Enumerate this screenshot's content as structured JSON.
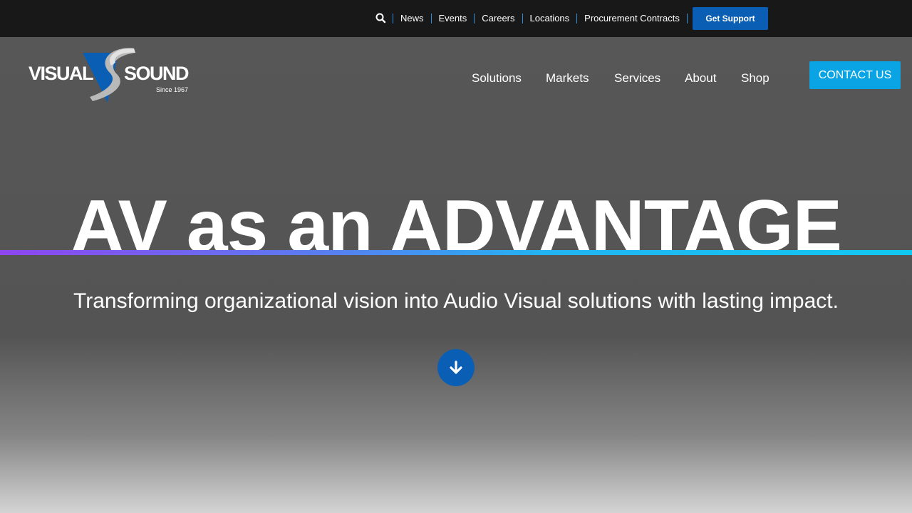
{
  "utility_bar": {
    "search_icon": "search-icon",
    "links": [
      "News",
      "Events",
      "Careers",
      "Locations",
      "Procurement Contracts"
    ],
    "support_button": "Get Support"
  },
  "logo": {
    "brand_left": "VISUAL",
    "brand_right": "SOUND",
    "since": "Since 1967"
  },
  "nav": {
    "items": [
      "Solutions",
      "Markets",
      "Services",
      "About",
      "Shop"
    ]
  },
  "contact_button": "CONTACT US",
  "hero": {
    "title": "AV as an ADVANTAGE",
    "subtitle": "Transforming organizational vision into Audio Visual solutions with lasting impact.",
    "scroll_icon": "arrow-down-icon"
  },
  "colors": {
    "utility_bar": "#181818",
    "support_button": "#0a5fb4",
    "contact_button": "#0aa3e3",
    "accent_purple": "#8f45ef",
    "accent_cyan": "#10c8f2"
  }
}
